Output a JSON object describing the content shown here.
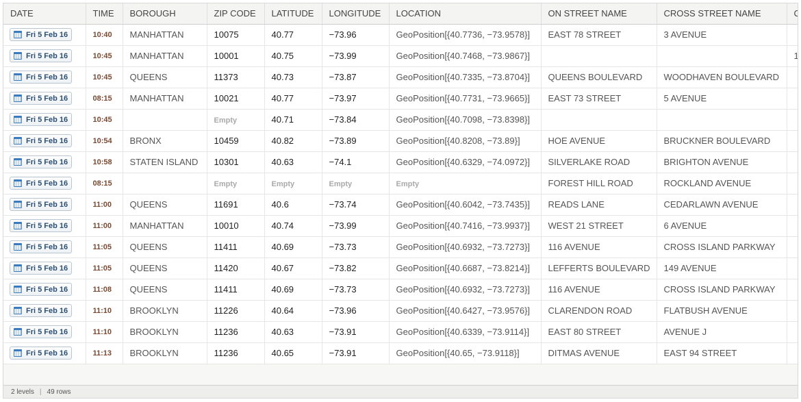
{
  "columns": [
    "DATE",
    "TIME",
    "BOROUGH",
    "ZIP CODE",
    "LATITUDE",
    "LONGITUDE",
    "LOCATION",
    "ON STREET NAME",
    "CROSS STREET NAME",
    "C"
  ],
  "rows": [
    {
      "date": "Fri 5 Feb 16",
      "time": "10:40",
      "borough": "MANHATTAN",
      "zip": "10075",
      "lat": "40.77",
      "lng": "−73.96",
      "location": "GeoPosition[{40.7736, −73.9578}]",
      "on_street": "EAST 78 STREET",
      "cross_street": "3 AVENUE",
      "extra": ""
    },
    {
      "date": "Fri 5 Feb 16",
      "time": "10:45",
      "borough": "MANHATTAN",
      "zip": "10001",
      "lat": "40.75",
      "lng": "−73.99",
      "location": "GeoPosition[{40.7468, −73.9867}]",
      "on_street": "",
      "cross_street": "",
      "extra": "1"
    },
    {
      "date": "Fri 5 Feb 16",
      "time": "10:45",
      "borough": "QUEENS",
      "zip": "11373",
      "lat": "40.73",
      "lng": "−73.87",
      "location": "GeoPosition[{40.7335, −73.8704}]",
      "on_street": "QUEENS BOULEVARD",
      "cross_street": "WOODHAVEN BOULEVARD",
      "extra": ""
    },
    {
      "date": "Fri 5 Feb 16",
      "time": "08:15",
      "borough": "MANHATTAN",
      "zip": "10021",
      "lat": "40.77",
      "lng": "−73.97",
      "location": "GeoPosition[{40.7731, −73.9665}]",
      "on_street": "EAST 73 STREET",
      "cross_street": "5 AVENUE",
      "extra": ""
    },
    {
      "date": "Fri 5 Feb 16",
      "time": "10:45",
      "borough": "",
      "zip": "Empty",
      "lat": "40.71",
      "lng": "−73.84",
      "location": "GeoPosition[{40.7098, −73.8398}]",
      "on_street": "",
      "cross_street": "",
      "extra": ""
    },
    {
      "date": "Fri 5 Feb 16",
      "time": "10:54",
      "borough": "BRONX",
      "zip": "10459",
      "lat": "40.82",
      "lng": "−73.89",
      "location": "GeoPosition[{40.8208, −73.89}]",
      "on_street": "HOE AVENUE",
      "cross_street": "BRUCKNER BOULEVARD",
      "extra": ""
    },
    {
      "date": "Fri 5 Feb 16",
      "time": "10:58",
      "borough": "STATEN ISLAND",
      "zip": "10301",
      "lat": "40.63",
      "lng": "−74.1",
      "location": "GeoPosition[{40.6329, −74.0972}]",
      "on_street": "SILVERLAKE ROAD",
      "cross_street": "BRIGHTON AVENUE",
      "extra": ""
    },
    {
      "date": "Fri 5 Feb 16",
      "time": "08:15",
      "borough": "",
      "zip": "Empty",
      "lat": "Empty",
      "lng": "Empty",
      "location": "Empty",
      "on_street": "FOREST HILL ROAD",
      "cross_street": "ROCKLAND AVENUE",
      "extra": ""
    },
    {
      "date": "Fri 5 Feb 16",
      "time": "11:00",
      "borough": "QUEENS",
      "zip": "11691",
      "lat": "40.6",
      "lng": "−73.74",
      "location": "GeoPosition[{40.6042, −73.7435}]",
      "on_street": "READS LANE",
      "cross_street": "CEDARLAWN AVENUE",
      "extra": ""
    },
    {
      "date": "Fri 5 Feb 16",
      "time": "11:00",
      "borough": "MANHATTAN",
      "zip": "10010",
      "lat": "40.74",
      "lng": "−73.99",
      "location": "GeoPosition[{40.7416, −73.9937}]",
      "on_street": "WEST 21 STREET",
      "cross_street": "6 AVENUE",
      "extra": ""
    },
    {
      "date": "Fri 5 Feb 16",
      "time": "11:05",
      "borough": "QUEENS",
      "zip": "11411",
      "lat": "40.69",
      "lng": "−73.73",
      "location": "GeoPosition[{40.6932, −73.7273}]",
      "on_street": "116 AVENUE",
      "cross_street": "CROSS ISLAND PARKWAY",
      "extra": ""
    },
    {
      "date": "Fri 5 Feb 16",
      "time": "11:05",
      "borough": "QUEENS",
      "zip": "11420",
      "lat": "40.67",
      "lng": "−73.82",
      "location": "GeoPosition[{40.6687, −73.8214}]",
      "on_street": "LEFFERTS BOULEVARD",
      "cross_street": "149 AVENUE",
      "extra": ""
    },
    {
      "date": "Fri 5 Feb 16",
      "time": "11:08",
      "borough": "QUEENS",
      "zip": "11411",
      "lat": "40.69",
      "lng": "−73.73",
      "location": "GeoPosition[{40.6932, −73.7273}]",
      "on_street": "116 AVENUE",
      "cross_street": "CROSS ISLAND PARKWAY",
      "extra": ""
    },
    {
      "date": "Fri 5 Feb 16",
      "time": "11:10",
      "borough": "BROOKLYN",
      "zip": "11226",
      "lat": "40.64",
      "lng": "−73.96",
      "location": "GeoPosition[{40.6427, −73.9576}]",
      "on_street": "CLARENDON ROAD",
      "cross_street": "FLATBUSH AVENUE",
      "extra": ""
    },
    {
      "date": "Fri 5 Feb 16",
      "time": "11:10",
      "borough": "BROOKLYN",
      "zip": "11236",
      "lat": "40.63",
      "lng": "−73.91",
      "location": "GeoPosition[{40.6339, −73.9114}]",
      "on_street": "EAST 80 STREET",
      "cross_street": "AVENUE J",
      "extra": ""
    },
    {
      "date": "Fri 5 Feb 16",
      "time": "11:13",
      "borough": "BROOKLYN",
      "zip": "11236",
      "lat": "40.65",
      "lng": "−73.91",
      "location": "GeoPosition[{40.65, −73.9118}]",
      "on_street": "DITMAS AVENUE",
      "cross_street": "EAST 94 STREET",
      "extra": ""
    }
  ],
  "footer": {
    "levels": "2 levels",
    "rows": "49 rows"
  },
  "empty_label": "Empty"
}
